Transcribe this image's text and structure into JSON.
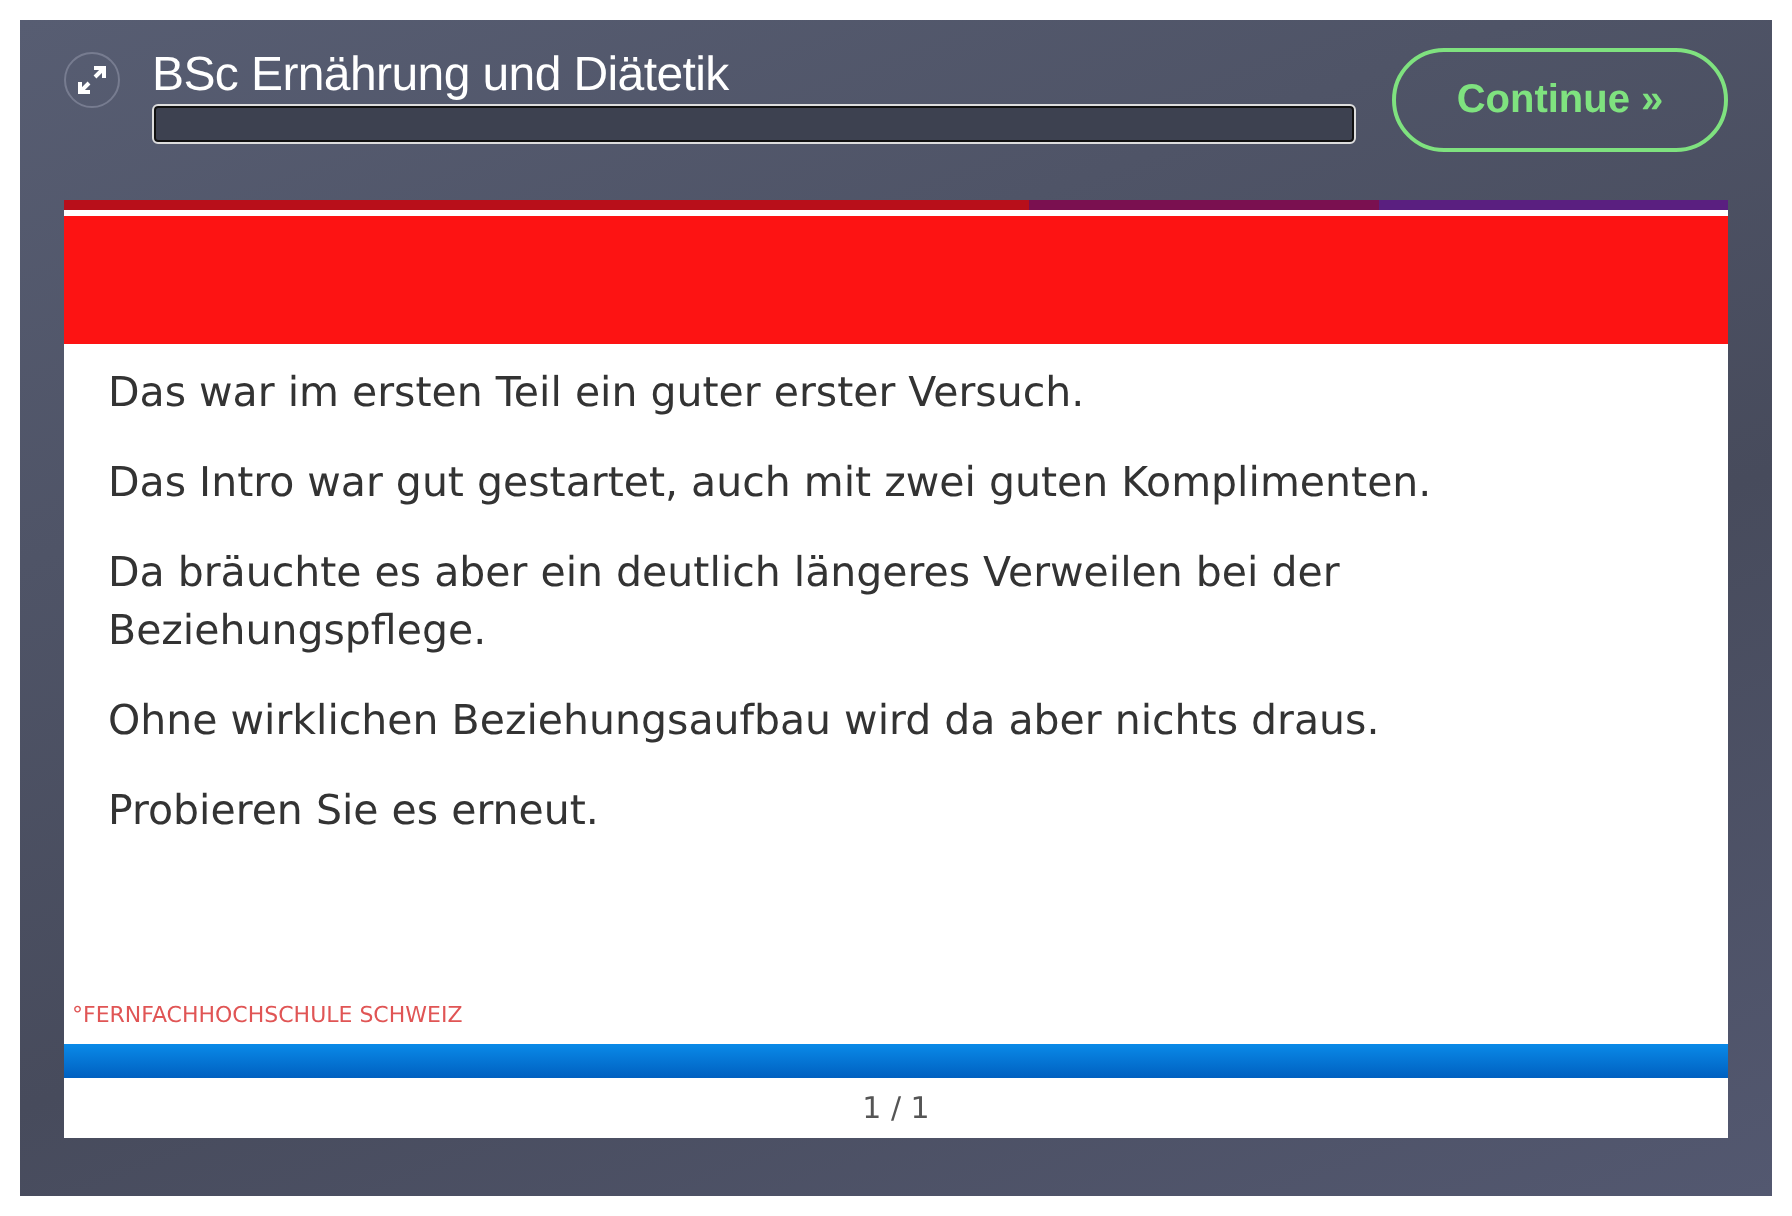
{
  "header": {
    "title": "BSc Ernährung und Diätetik",
    "progress": {
      "level": 0
    },
    "continue_button": "Continue »"
  },
  "slide": {
    "paragraphs": [
      "Das war im ersten Teil ein guter erster Versuch.",
      "Das Intro war gut gestartet, auch mit zwei guten Komplimenten.",
      "Da bräuchte es aber ein deutlich längeres Verweilen bei der Beziehungspflege.",
      "Ohne wirklichen Beziehungsaufbau wird da aber nichts draus.",
      "Probieren Sie es erneut."
    ],
    "footer": "°FERNFACHHOCHSCHULE SCHWEIZ",
    "page_indicator": "1 / 1"
  }
}
